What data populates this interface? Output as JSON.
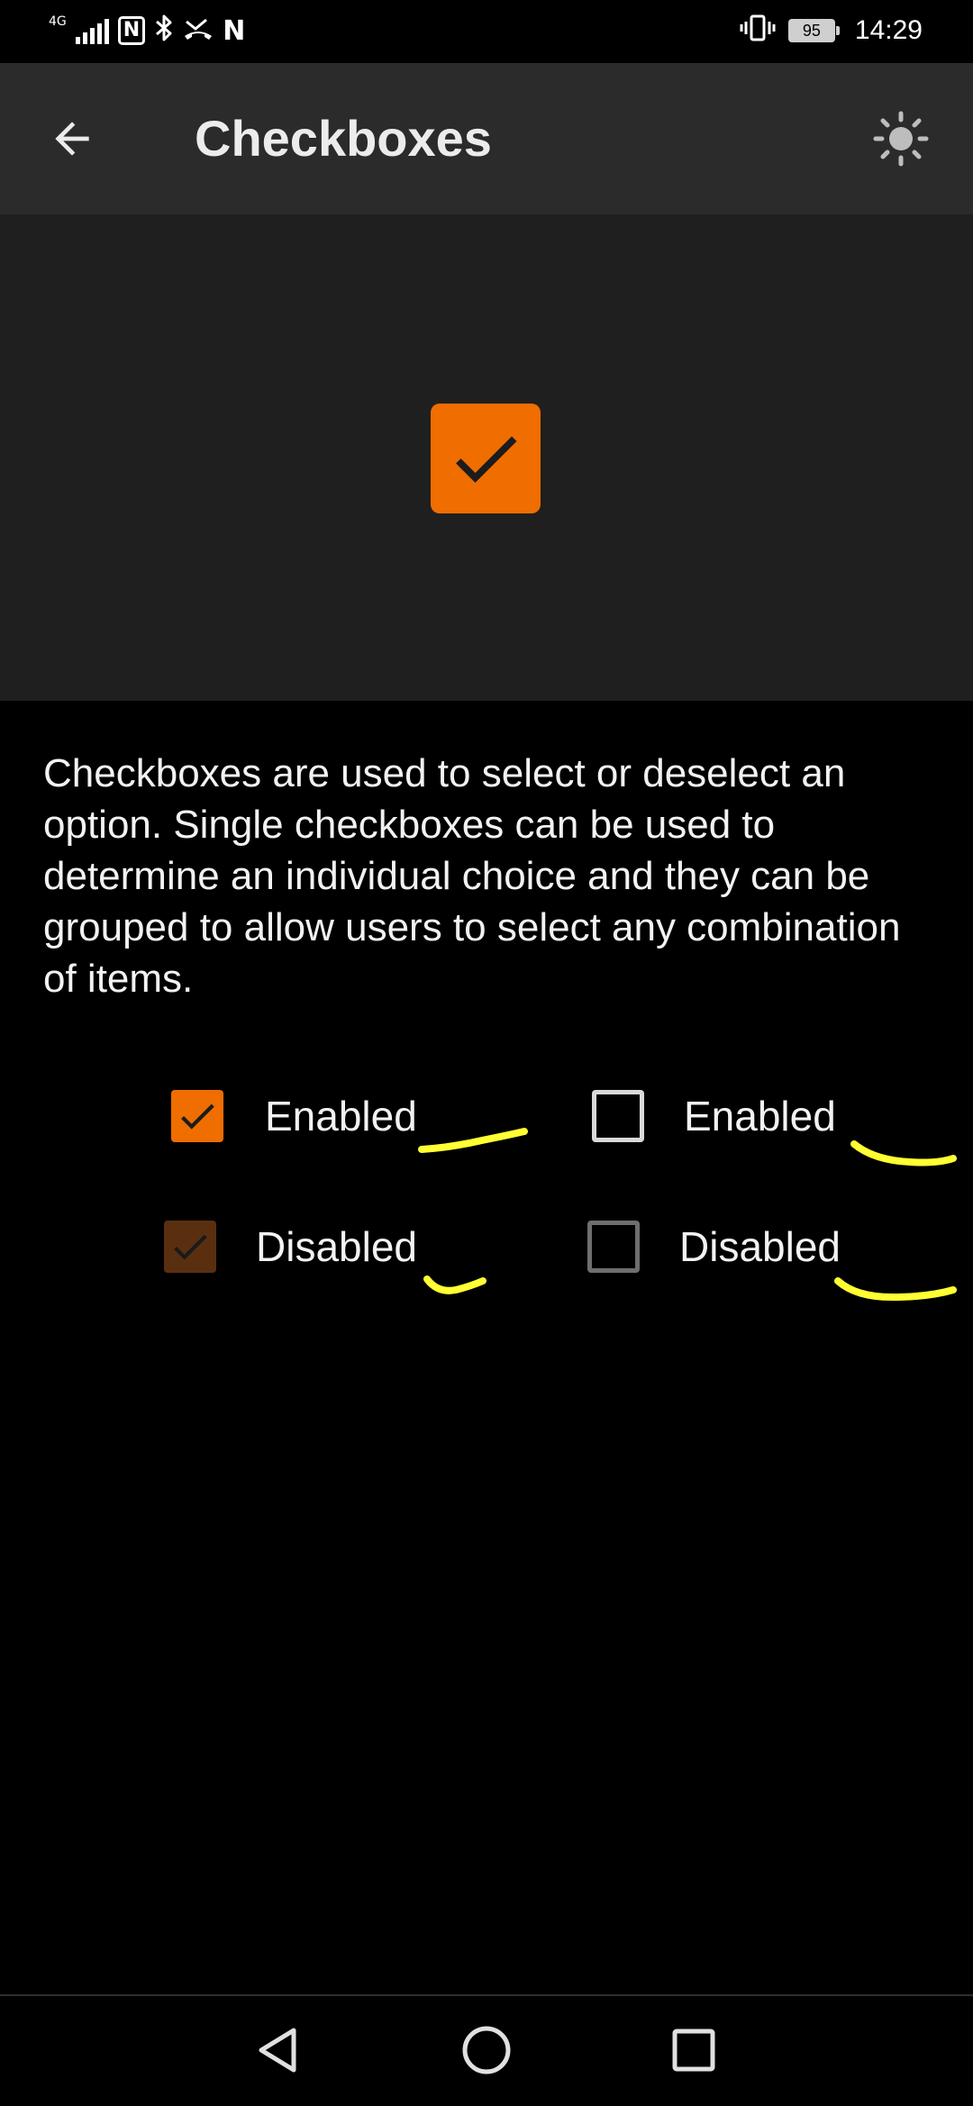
{
  "status_bar": {
    "network": "4G",
    "nfc": "N",
    "carrier_icon": "N",
    "battery": "95",
    "time": "14:29"
  },
  "app_bar": {
    "title": "Checkboxes",
    "back_icon": "arrow-back-icon",
    "theme_icon": "brightness-icon"
  },
  "preview": {
    "checked": true,
    "color": "#f06d00"
  },
  "description": "Checkboxes are used to select or deselect an option. Single checkboxes can be used to determine an individual choice and they can be grouped to allow users to select any combination of items.",
  "checkboxes": [
    {
      "label": "Enabled",
      "checked": true,
      "enabled": true
    },
    {
      "label": "Enabled",
      "checked": false,
      "enabled": true
    },
    {
      "label": "Disabled",
      "checked": true,
      "enabled": false
    },
    {
      "label": "Disabled",
      "checked": false,
      "enabled": false
    }
  ],
  "colors": {
    "accent": "#f06d00",
    "accent_disabled": "#5a2f10",
    "app_bar": "#2b2b2b",
    "preview_bg": "#1f1f1f",
    "annotation": "#ffff33"
  },
  "nav_bar": {
    "back": "back-triangle-icon",
    "home": "home-circle-icon",
    "recents": "recents-square-icon"
  }
}
